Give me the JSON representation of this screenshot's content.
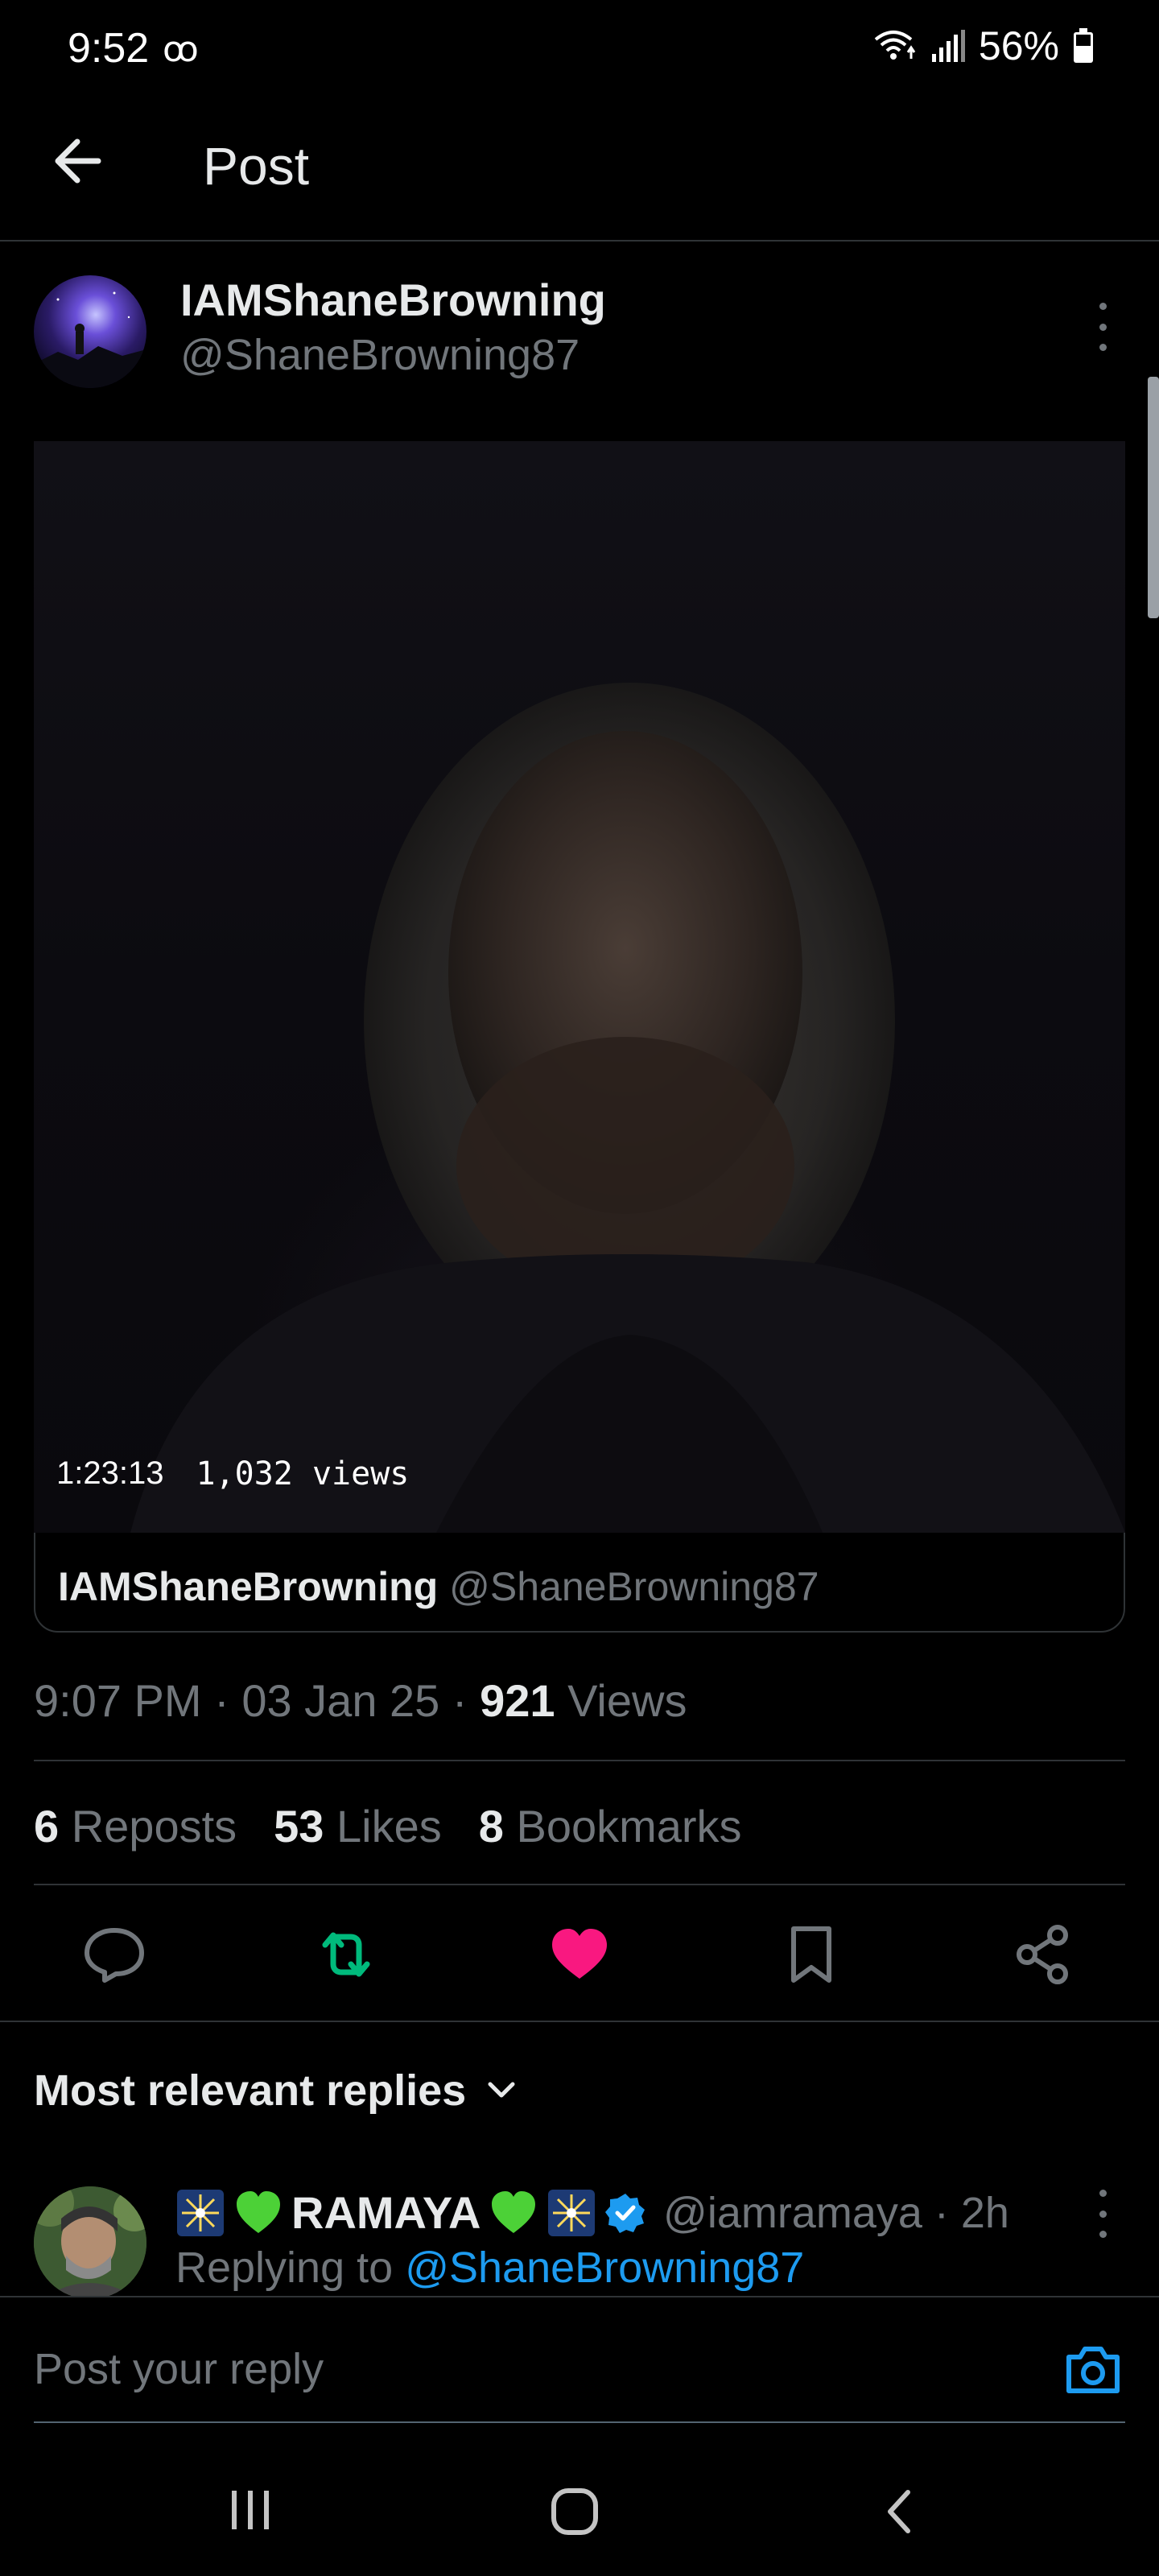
{
  "status_bar": {
    "time": "9:52",
    "voicemail_icon": "ꝏ",
    "battery": "56%"
  },
  "header": {
    "title": "Post"
  },
  "post": {
    "author_name": "IAMShaneBrowning",
    "author_handle": "@ShaneBrowning87",
    "video": {
      "duration": "1:23:13",
      "views": "1,032 views",
      "card_author_name": "IAMShaneBrowning",
      "card_author_handle": "@ShaneBrowning87"
    },
    "time": "9:07 PM",
    "date": "03 Jan 25",
    "views_count": "921",
    "views_label": "Views",
    "reposts_count": "6",
    "reposts_label": "Reposts",
    "likes_count": "53",
    "likes_label": "Likes",
    "bookmarks_count": "8",
    "bookmarks_label": "Bookmarks"
  },
  "replies": {
    "heading": "Most relevant replies",
    "first": {
      "name": "RAMAYA",
      "handle": "@iamramaya",
      "age": "2h",
      "replying_prefix": "Replying to",
      "replying_to": "@ShaneBrowning87"
    }
  },
  "composer": {
    "placeholder": "Post your reply"
  },
  "colors": {
    "accent_blue": "#1d9bf0",
    "repost_green": "#00ba7c",
    "like_pink": "#f91880",
    "muted": "#71767b"
  }
}
